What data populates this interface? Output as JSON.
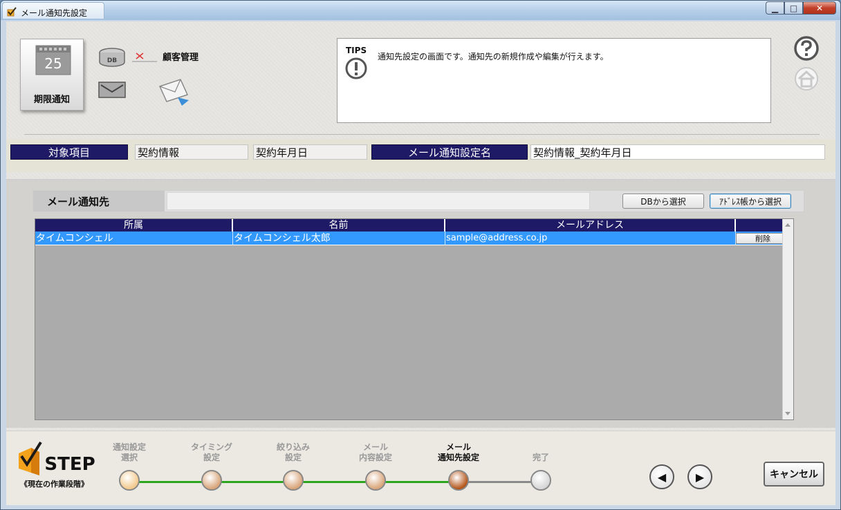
{
  "window": {
    "title": "メール通知先設定"
  },
  "header": {
    "main_function_label": "期限通知",
    "calendar_number": "25",
    "db_icon_text": "DB",
    "customer_label": "顧客管理"
  },
  "tips": {
    "heading": "TIPS",
    "text": "通知先設定の画面です。通知先の新規作成や編集が行えます。"
  },
  "info_row": {
    "target_label": "対象項目",
    "target_value1": "契約情報",
    "target_value2": "契約年月日",
    "setting_name_label": "メール通知設定名",
    "setting_name_value": "契約情報_契約年月日"
  },
  "destination": {
    "label": "メール通知先",
    "value": "",
    "db_select_button": "DBから選択",
    "addressbook_select_button": "ｱﾄﾞﾚｽ帳から選択"
  },
  "grid": {
    "columns": [
      "所属",
      "名前",
      "メールアドレス",
      ""
    ],
    "rows": [
      {
        "affiliation": "タイムコンシェル",
        "name": "タイムコンシェル太郎",
        "email": "sample@address.co.jp",
        "delete_label": "削除"
      }
    ]
  },
  "steps": {
    "logo_text": "STEP",
    "subtitle": "《現在の作業段階》",
    "items": [
      {
        "label": "通知設定\n選択",
        "state": "done",
        "color": "#f3c98c"
      },
      {
        "label": "タイミング\n設定",
        "state": "done",
        "color": "#d9a57a"
      },
      {
        "label": "絞り込み\n設定",
        "state": "done",
        "color": "#d9a57a"
      },
      {
        "label": "メール\n内容設定",
        "state": "done",
        "color": "#d9a57a"
      },
      {
        "label": "メール\n通知先設定",
        "state": "current",
        "color": "#b5561b"
      },
      {
        "label": "完了",
        "state": "todo",
        "color": "#d6d6d6"
      }
    ],
    "prev_icon": "◀",
    "next_icon": "▶",
    "cancel_label": "キャンセル"
  }
}
